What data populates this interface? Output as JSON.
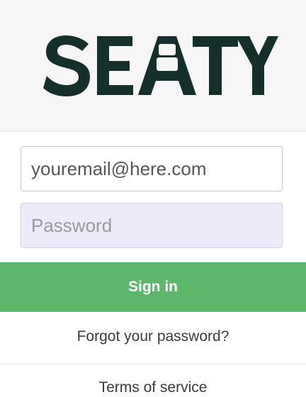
{
  "brand": {
    "logo_text": "SEATY",
    "logo_color": "#15302a",
    "header_bg": "#f6f6f6"
  },
  "login": {
    "email_value": "youremail@here.com",
    "password_placeholder": "Password",
    "sign_in_label": "Sign in",
    "forgot_label": "Forgot your password?",
    "terms_label": "Terms of service"
  },
  "colors": {
    "sign_in_bg": "#5cb76a",
    "password_field_bg": "#ebebfa"
  }
}
